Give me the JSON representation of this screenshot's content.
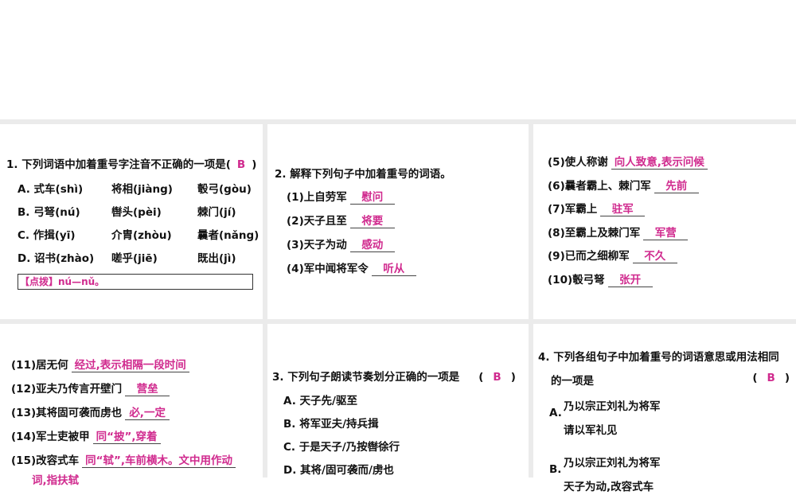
{
  "q1": {
    "title": "1. 下列词语中加着重号字注音不正确的一项是(",
    "answer": "B",
    "close": ")",
    "rows": [
      [
        "A. 式车(shì)",
        "将相(jiàng)",
        "彀弓(gòu)"
      ],
      [
        "B. 弓弩(nú)",
        "辔头(pèi)",
        "棘门(jí)"
      ],
      [
        "C. 作揖(yī)",
        "介胄(zhòu)",
        "曩者(nǎng)"
      ],
      [
        "D. 诏书(zhào)",
        "嗟乎(jiē)",
        "既出(jì)"
      ]
    ],
    "note": "【点拨】nú—nǔ。"
  },
  "q2": {
    "title": "2. 解释下列句子中加着重号的词语。",
    "items": [
      {
        "q": "(1)上自劳军",
        "a": "慰问"
      },
      {
        "q": "(2)天子且至",
        "a": "将要"
      },
      {
        "q": "(3)天子为动",
        "a": "感动"
      },
      {
        "q": "(4)军中闻将军令",
        "a": "听从"
      }
    ]
  },
  "q2b": {
    "items": [
      {
        "q": "(5)使人称谢",
        "a": "向人致意,表示问候"
      },
      {
        "q": "(6)曩者霸上、棘门军",
        "a": "先前"
      },
      {
        "q": "(7)军霸上",
        "a": "驻军"
      },
      {
        "q": "(8)至霸上及棘门军",
        "a": "军营"
      },
      {
        "q": "(9)已而之细柳军",
        "a": "不久"
      },
      {
        "q": "(10)彀弓弩",
        "a": "张开"
      }
    ]
  },
  "q2c": {
    "items": [
      {
        "q": "(11)居无何",
        "a": "经过,表示相隔一段时间"
      },
      {
        "q": "(12)亚夫乃传言开壁门",
        "a": "营垒"
      },
      {
        "q": "(13)其将固可袭而虏也",
        "a": "必,一定"
      },
      {
        "q": "(14)军士吏被甲",
        "a": "同“披”,穿着"
      },
      {
        "q": "(15)改容式车",
        "a": "同“轼”,车前横木。文中用作动"
      }
    ],
    "cont": "词,指扶轼"
  },
  "q3": {
    "title": "3. 下列句子朗读节奏划分正确的一项是",
    "answer": "B",
    "options": [
      "A. 天子先/驱至",
      "B. 将军亚夫/持兵揖",
      "C. 于是天子/乃按辔徐行",
      "D. 其将/固可袭而/虏也"
    ]
  },
  "q4": {
    "title": "4. 下列各组句子中加着重号的词语意思或用法相同",
    "title2": "的一项是",
    "answer": "B",
    "A": {
      "label": "A.",
      "lines": [
        "乃以宗正刘礼为将军",
        "请以军礼见"
      ]
    },
    "B": {
      "label": "B.",
      "lines": [
        "乃以宗正刘礼为将军",
        "天子为动,改容式车"
      ]
    }
  }
}
